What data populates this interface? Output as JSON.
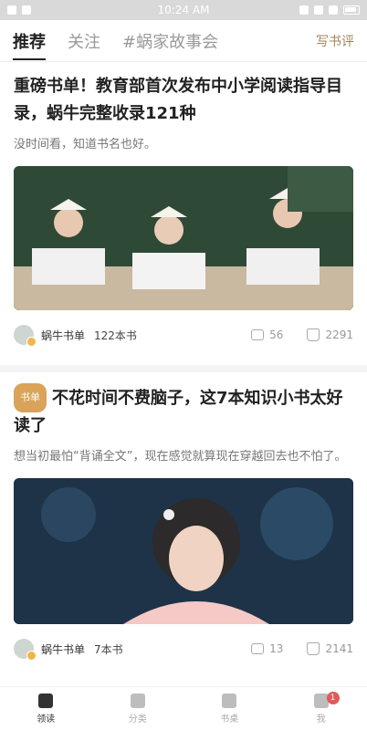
{
  "status": {
    "time": "10:24 AM"
  },
  "tabs": [
    {
      "label": "推荐"
    },
    {
      "label": "关注"
    },
    {
      "label": "#蜗家故事会"
    }
  ],
  "write_label": "写书评",
  "cards": [
    {
      "title": "重磅书单！教育部首次发布中小学阅读指导目录，蜗牛完整收录121种",
      "desc": "没时间看，知道书名也好。",
      "author": "蜗牛书单",
      "book_count": "122本书",
      "comments": "56",
      "likes": "2291",
      "badge": ""
    },
    {
      "badge": "书单",
      "title": "不花时间不费脑子，这7本知识小书太好读了",
      "desc": "想当初最怕“背诵全文”，现在感觉就算现在穿越回去也不怕了。",
      "author": "蜗牛书单",
      "book_count": "7本书",
      "comments": "13",
      "likes": "2141"
    }
  ],
  "nav": [
    {
      "label": "领读"
    },
    {
      "label": "分类"
    },
    {
      "label": "书桌"
    },
    {
      "label": "我",
      "badge": "1"
    }
  ]
}
